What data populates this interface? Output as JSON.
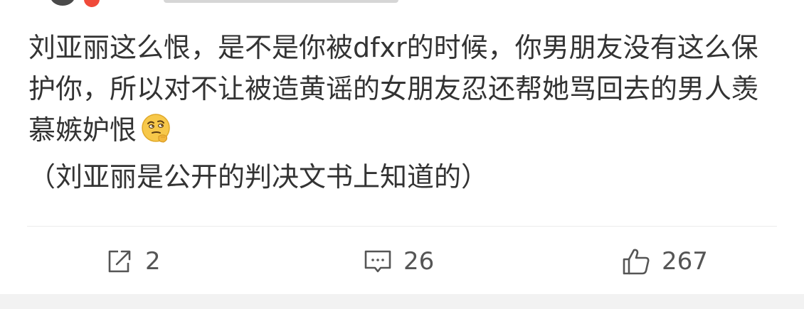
{
  "post": {
    "text": "刘亚丽这么恨，是不是你被dfxr的时候，你男朋友没有这么保护你，所以对不让被造黄谣的女朋友忍还帮她骂回去的男人羡慕嫉妒恨",
    "note": "（刘亚丽是公开的判决文书上知道的）",
    "emoji": "thinking-face-icon"
  },
  "actions": {
    "repost_count": "2",
    "comment_count": "26",
    "like_count": "267"
  },
  "icons": {
    "repost": "repost-icon",
    "comment": "comment-icon",
    "like": "thumbs-up-icon"
  },
  "colors": {
    "text": "#333333",
    "counter": "#555555",
    "divider": "#ececec",
    "background": "#ffffff",
    "bottom_band": "#f2f2f2",
    "emoji_face": "#f7c84a"
  }
}
